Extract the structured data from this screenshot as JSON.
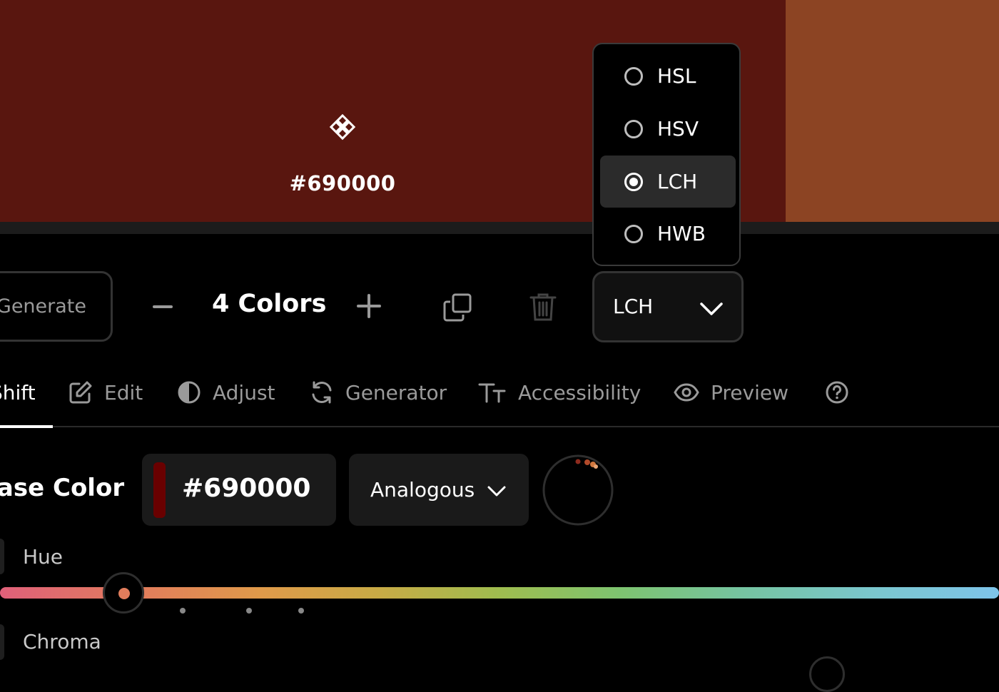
{
  "swatches": [
    {
      "color": "#59160f",
      "hex_label": "#690000"
    },
    {
      "color": "#8c4423"
    }
  ],
  "color_mode_menu": {
    "options": [
      "HSL",
      "HSV",
      "LCH",
      "HWB"
    ],
    "selected": "LCH"
  },
  "toolbar": {
    "generate_label": "Generate",
    "color_count_label": "4 Colors",
    "mode_value": "LCH"
  },
  "tabs": [
    {
      "label": "Shift",
      "icon": "shift-icon",
      "active": true
    },
    {
      "label": "Edit",
      "icon": "pencil-square-icon"
    },
    {
      "label": "Adjust",
      "icon": "half-circle-icon"
    },
    {
      "label": "Generator",
      "icon": "refresh-icon"
    },
    {
      "label": "Accessibility",
      "icon": "text-size-icon"
    },
    {
      "label": "Preview",
      "icon": "eye-icon"
    },
    {
      "label": "",
      "icon": "help-circle-icon"
    }
  ],
  "base_color": {
    "label": "Base Color",
    "hex_value": "#690000",
    "chip_color": "#690000",
    "harmony": "Analogous"
  },
  "sliders": {
    "hue_label": "Hue",
    "chroma_label": "Chroma"
  }
}
